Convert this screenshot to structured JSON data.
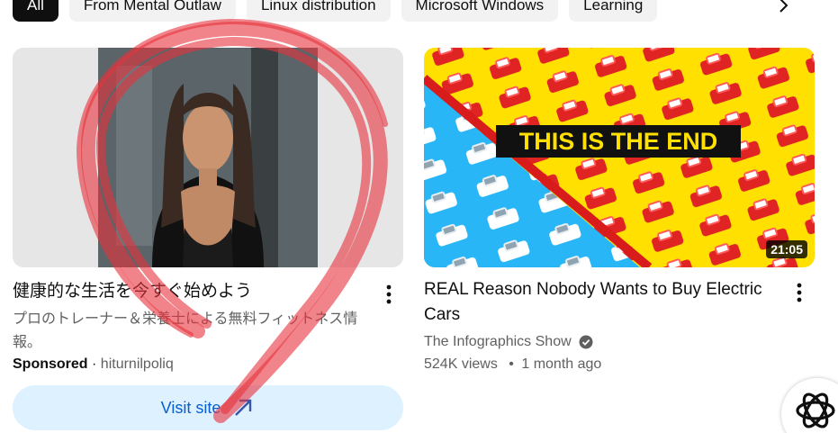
{
  "chips": [
    {
      "label": "All",
      "active": true
    },
    {
      "label": "From Mental Outlaw",
      "active": false
    },
    {
      "label": "Linux distribution",
      "active": false
    },
    {
      "label": "Microsoft Windows",
      "active": false
    },
    {
      "label": "Learning",
      "active": false
    }
  ],
  "ad": {
    "title": "健康的な生活を今すぐ始めよう",
    "description": "プロのトレーナー＆栄養士による無料フィットネス情報。",
    "sponsored_label": "Sponsored",
    "separator": "·",
    "advertiser": "hiturnilpoliq",
    "cta_label": "Visit site"
  },
  "video": {
    "title": "REAL Reason Nobody Wants to Buy Electric Cars",
    "thumbnail_text": "THIS IS THE END",
    "duration": "21:05",
    "channel": "The Infographics Show",
    "views": "524K views",
    "age": "1 month ago",
    "stats_separator": "•"
  },
  "icons": {
    "chevron": "chevron-right-icon",
    "kebab": "more-vert-icon",
    "verified": "verified-badge-icon",
    "external": "external-link-arrow-icon",
    "logo": "openai-logo-icon"
  },
  "colors": {
    "annotation": "#e8323c",
    "accent": "#065fd4",
    "cta_bg": "#def1ff"
  }
}
